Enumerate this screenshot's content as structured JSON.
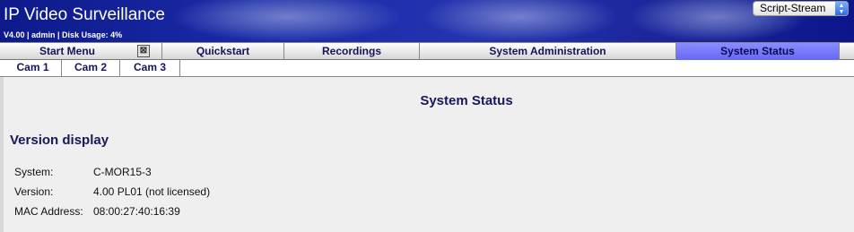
{
  "header": {
    "title": "IP Video Surveillance",
    "info": "V4.00 | admin | Disk Usage: 4%",
    "stream_select": "Script-Stream"
  },
  "nav": {
    "items": [
      "Start Menu",
      "Quickstart",
      "Recordings",
      "System Administration",
      "System Status"
    ],
    "active": "System Status"
  },
  "subnav": {
    "items": [
      "Cam 1",
      "Cam 2",
      "Cam 3"
    ]
  },
  "page": {
    "title": "System Status",
    "section": "Version display",
    "rows": [
      {
        "label": "System:",
        "value": "C-MOR15-3"
      },
      {
        "label": "Version:",
        "value": "4.00 PL01 (not licensed)"
      },
      {
        "label": "MAC Address:",
        "value": "08:00:27:40:16:39"
      }
    ]
  }
}
